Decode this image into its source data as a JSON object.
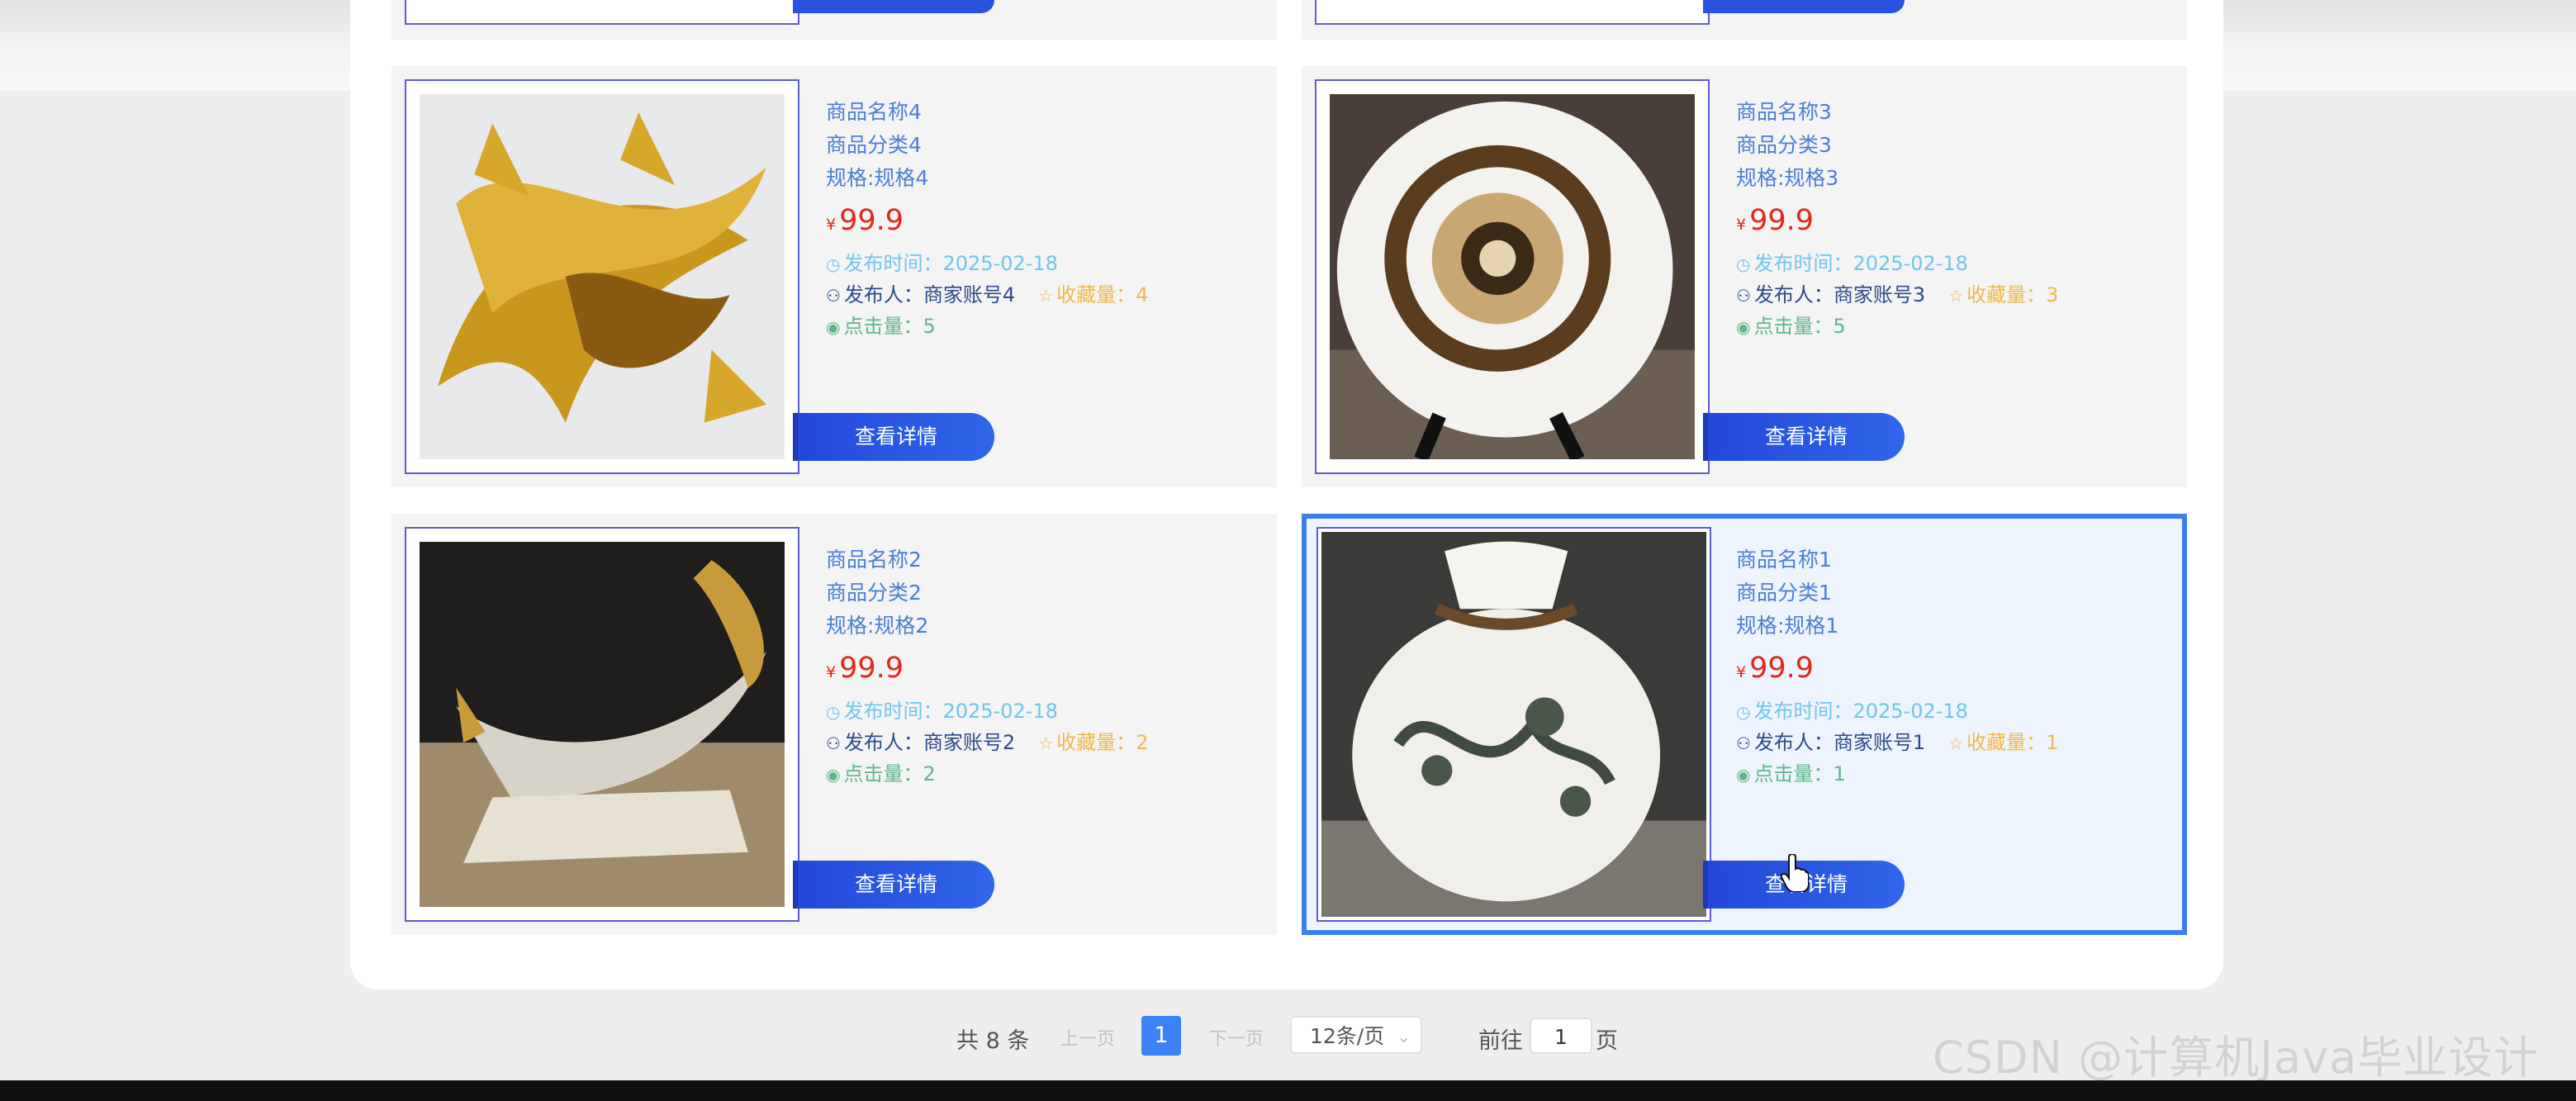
{
  "products": [
    {
      "name": "商品名称4",
      "category": "商品分类4",
      "spec": "规格:规格4",
      "currency": "¥",
      "price": "99.9",
      "time_label": "发布时间：",
      "time": "2025-02-18",
      "publisher_label": "发布人：",
      "publisher": "商家账号4",
      "fav_label": "收藏量：",
      "fav": "4",
      "clicks_label": "点击量：",
      "clicks": "5",
      "button": "查看详情",
      "image_icon": "gold-dragon-sculpture"
    },
    {
      "name": "商品名称3",
      "category": "商品分类3",
      "spec": "规格:规格3",
      "currency": "¥",
      "price": "99.9",
      "time_label": "发布时间：",
      "time": "2025-02-18",
      "publisher_label": "发布人：",
      "publisher": "商家账号3",
      "fav_label": "收藏量：",
      "fav": "3",
      "clicks_label": "点击量：",
      "clicks": "5",
      "button": "查看详情",
      "image_icon": "decorative-plate"
    },
    {
      "name": "商品名称2",
      "category": "商品分类2",
      "spec": "规格:规格2",
      "currency": "¥",
      "price": "99.9",
      "time_label": "发布时间：",
      "time": "2025-02-18",
      "publisher_label": "发布人：",
      "publisher": "商家账号2",
      "fav_label": "收藏量：",
      "fav": "2",
      "clicks_label": "点击量：",
      "clicks": "2",
      "button": "查看详情",
      "image_icon": "crystal-boat"
    },
    {
      "name": "商品名称1",
      "category": "商品分类1",
      "spec": "规格:规格1",
      "currency": "¥",
      "price": "99.9",
      "time_label": "发布时间：",
      "time": "2025-02-18",
      "publisher_label": "发布人：",
      "publisher": "商家账号1",
      "fav_label": "收藏量：",
      "fav": "1",
      "clicks_label": "点击量：",
      "clicks": "1",
      "button": "查看详情",
      "image_icon": "porcelain-vase"
    }
  ],
  "pagination": {
    "total": "共 8 条",
    "prev": "上一页",
    "current": "1",
    "next": "下一页",
    "page_size": "12条/页",
    "goto": "前往",
    "goto_value": "1",
    "page_word": "页"
  },
  "watermark": "CSDN @计算机Java毕业设计",
  "colors": {
    "accent": "#3b82f6",
    "price": "#e0291e",
    "button": "#2348d8",
    "active_border": "#3b80e8"
  }
}
